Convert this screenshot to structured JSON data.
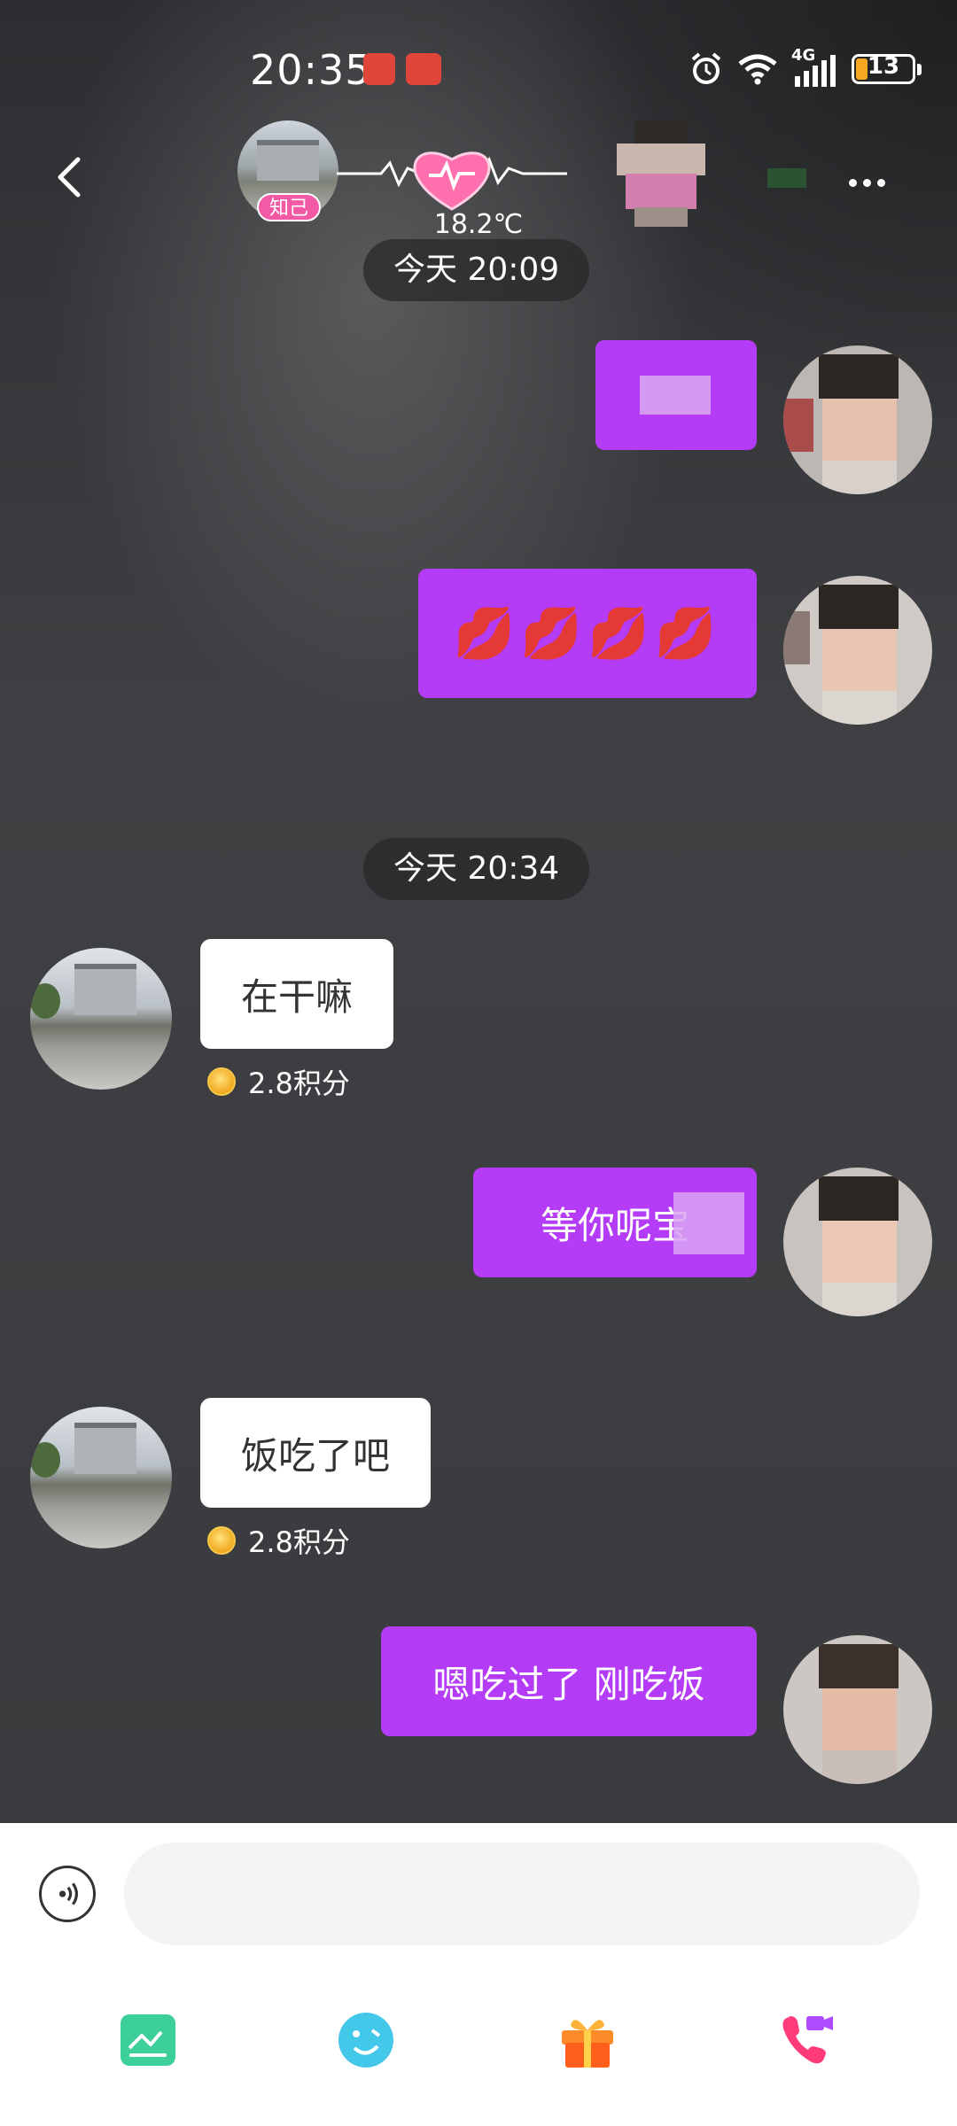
{
  "status_bar": {
    "time": "20:35",
    "battery_level": "13",
    "network": "4G"
  },
  "header": {
    "badge": "知己",
    "temperature": "18.2℃",
    "icons": {
      "back": "back-chevron-icon",
      "heart": "heartbeat-icon",
      "more": "more-dots-icon"
    }
  },
  "messages": [
    {
      "type": "time",
      "text": "今天 20:09"
    },
    {
      "type": "out",
      "text": ""
    },
    {
      "type": "out",
      "text": "💋💋💋💋"
    },
    {
      "type": "time",
      "text": "今天 20:34"
    },
    {
      "type": "in",
      "text": "在干嘛",
      "points": "2.8积分"
    },
    {
      "type": "out",
      "text": "等你呢宝"
    },
    {
      "type": "in",
      "text": "饭吃了吧",
      "points": "2.8积分"
    },
    {
      "type": "out",
      "text": "嗯吃过了 刚吃饭"
    }
  ],
  "input": {
    "placeholder": ""
  },
  "toolbar": [
    {
      "name": "album",
      "icon": "image-icon",
      "color": "#3ccf9a"
    },
    {
      "name": "emoji",
      "icon": "emoji-icon",
      "color": "#43c8ea"
    },
    {
      "name": "gift",
      "icon": "gift-icon",
      "color": "#ff6a1f"
    },
    {
      "name": "video-call",
      "icon": "video-call-icon",
      "color": "#ff3b7a"
    }
  ],
  "colors": {
    "outgoing_bubble": "#b43cf6",
    "incoming_bubble": "#ffffff",
    "badge": "#f25aa5"
  }
}
